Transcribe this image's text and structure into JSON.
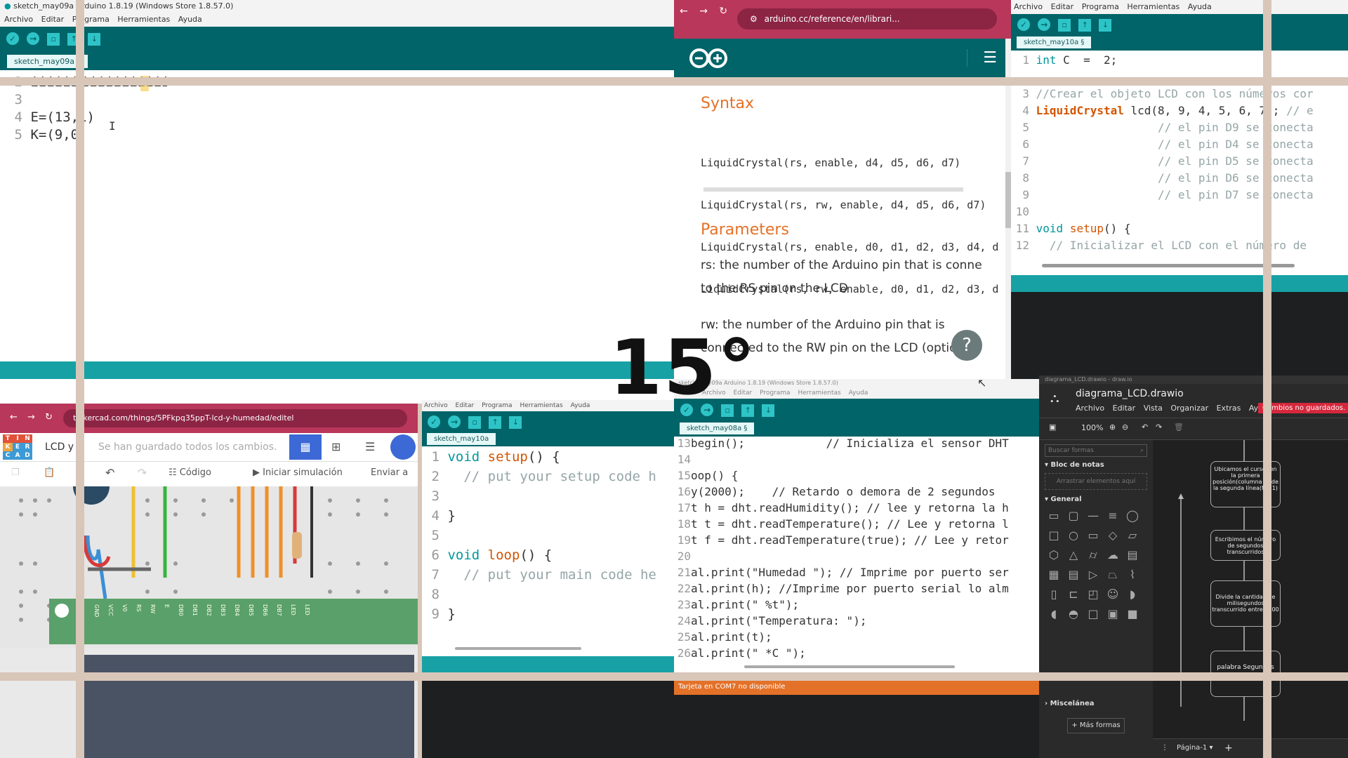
{
  "overlay": {
    "angle": "15°"
  },
  "ide1": {
    "title": "sketch_may09a Arduino 1.8.19 (Windows Store 1.8.57.0)",
    "menu": [
      "Archivo",
      "Editar",
      "Programa",
      "Herramientas",
      "Ayuda"
    ],
    "tab": "sketch_may09a §",
    "lines": [
      {
        "n": "2",
        "code": "iiiiiiiiiiiiiii"
      },
      {
        "n": "3",
        "code": ""
      },
      {
        "n": "4",
        "code": "E=(13,1)"
      },
      {
        "n": "5",
        "code": "K=(9,0"
      }
    ]
  },
  "browser": {
    "url": "arduino.cc/reference/en/librari...",
    "syntax_heading": "Syntax",
    "syntax_lines": [
      "LiquidCrystal(rs, enable, d4, d5, d6, d7)",
      "LiquidCrystal(rs, rw, enable, d4, d5, d6, d7)",
      "LiquidCrystal(rs, enable, d0, d1, d2, d3, d4, d",
      "LiquidCrystal(rs, rw, enable, d0, d1, d2, d3, d"
    ],
    "params_heading": "Parameters",
    "param_rs_1": "rs: the number of the Arduino pin that is conne",
    "param_rs_2": "to the RS pin on the LCD",
    "param_rw_1": "rw: the number of the Arduino pin that is",
    "param_rw_2": "connected to the RW pin on the LCD (optional)"
  },
  "ide2": {
    "menu": [
      "Archivo",
      "Editar",
      "Programa",
      "Herramientas",
      "Ayuda"
    ],
    "tab": "sketch_may10a §",
    "lines": [
      {
        "n": "1",
        "code": "int C  =  2;"
      },
      {
        "n": "3",
        "code": "//Crear el objeto LCD con los números cor"
      },
      {
        "n": "4",
        "code": "LiquidCrystal lcd(8, 9, 4, 5, 6, 7); // e"
      },
      {
        "n": "5",
        "code": "                  // el pin D9 se conecta"
      },
      {
        "n": "6",
        "code": "                  // el pin D4 se conecta"
      },
      {
        "n": "7",
        "code": "                  // el pin D5 se conecta"
      },
      {
        "n": "8",
        "code": "                  // el pin D6 se conecta"
      },
      {
        "n": "9",
        "code": "                  // el pin D7 se conecta"
      },
      {
        "n": "10",
        "code": ""
      },
      {
        "n": "11",
        "code": "void setup() {"
      },
      {
        "n": "12",
        "code": "  // Inicializar el LCD con el número de"
      }
    ]
  },
  "tinkercad": {
    "url": "tinkercad.com/things/5PFkpq35ppT-lcd-y-humedad/editel",
    "logo": [
      "TIN",
      "KER",
      "CAD"
    ],
    "project": "LCD y",
    "saved": "Se han guardado todos los cambios.",
    "code_btn": "Código",
    "sim_btn": "Iniciar simulación",
    "send_btn": "Enviar a",
    "pins": [
      "GND",
      "VCC",
      "V0",
      "RS",
      "RW",
      "E",
      "DB0",
      "DB1",
      "DB2",
      "DB3",
      "DB4",
      "DB5",
      "DB6",
      "DB7",
      "LED",
      "LED"
    ]
  },
  "ide3": {
    "menu": [
      "Archivo",
      "Editar",
      "Programa",
      "Herramientas",
      "Ayuda"
    ],
    "tab": "sketch_may10a",
    "lines": [
      {
        "n": "1",
        "code": "void setup() {"
      },
      {
        "n": "2",
        "code": "  // put your setup code h"
      },
      {
        "n": "3",
        "code": ""
      },
      {
        "n": "4",
        "code": "}"
      },
      {
        "n": "5",
        "code": ""
      },
      {
        "n": "6",
        "code": "void loop() {"
      },
      {
        "n": "7",
        "code": "  // put your main code he"
      },
      {
        "n": "8",
        "code": ""
      },
      {
        "n": "9",
        "code": "}"
      }
    ]
  },
  "ide4": {
    "title": "sketch_may09a Arduino 1.8.19 (Windows Store 1.8.57.0)",
    "menu": [
      "Archivo",
      "Editar",
      "Programa",
      "Herramientas",
      "Ayuda"
    ],
    "tab": "sketch_may08a §",
    "lines": [
      {
        "n": "13",
        "code": "begin();            // Inicializa el sensor DHT"
      },
      {
        "n": "14",
        "code": ""
      },
      {
        "n": "15",
        "code": "oop() {"
      },
      {
        "n": "16",
        "code": "y(2000);    // Retardo o demora de 2 segundos"
      },
      {
        "n": "17",
        "code": "t h = dht.readHumidity(); // lee y retorna la h"
      },
      {
        "n": "18",
        "code": "t t = dht.readTemperature(); // Lee y retorna l"
      },
      {
        "n": "19",
        "code": "t f = dht.readTemperature(true); // Lee y retor"
      },
      {
        "n": "20",
        "code": ""
      },
      {
        "n": "21",
        "code": "al.print(\"Humedad \"); // Imprime por puerto ser"
      },
      {
        "n": "22",
        "code": "al.print(h); //Imprime por puerto serial lo alm"
      },
      {
        "n": "23",
        "code": "al.print(\" %t\");"
      },
      {
        "n": "24",
        "code": "al.print(\"Temperatura: \");"
      },
      {
        "n": "25",
        "code": "al.print(t);"
      },
      {
        "n": "26",
        "code": "al.print(\" *C \");"
      }
    ],
    "status": "Tarjeta en COM7 no disponible"
  },
  "drawio": {
    "title": "diagrama_LCD.drawio - draw.io",
    "filename": "diagrama_LCD.drawio",
    "menu": [
      "Archivo",
      "Editar",
      "Vista",
      "Organizar",
      "Extras",
      "Ayuda"
    ],
    "unsaved": "Cambios no guardados. Haga c",
    "zoom": "100%",
    "search_placeholder": "Buscar formas",
    "notes_header": "Bloc de notas",
    "notes_drop": "Arrastrar elementos aquí",
    "general_header": "General",
    "misc_header": "Miscelánea",
    "more_shapes": "+ Más formas",
    "page_tab": "Página-1",
    "nodes": [
      "Ubicamos el cursor en la primera posición(columna 0) de la segunda línea(fila 1)",
      "Escribimos el número de segundos transcurridos",
      "Divide la cantidad de milisegundos transcurrido entre 1000",
      "palabra Segundos"
    ]
  },
  "colors": {
    "teal_dark": "#006468",
    "teal": "#17a1a5",
    "orange": "#e47128",
    "arduino": "#00979c"
  }
}
